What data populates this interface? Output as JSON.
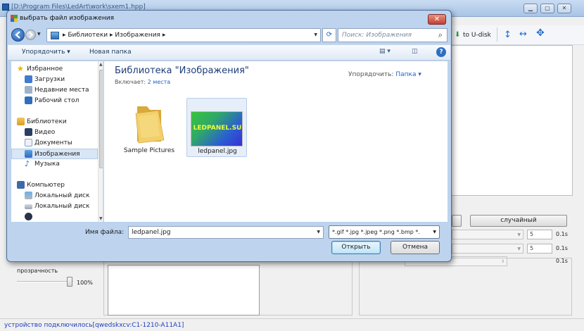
{
  "background_app": {
    "title": "[D:\\Program Files\\LedArt\\work\\sxem1.hpp]",
    "toolbar": {
      "u_disk_label": "to U-disk"
    },
    "random_button": "случайный",
    "transparency_label": "прозрачность",
    "transparency_value": "100%",
    "spin_values": [
      "5",
      "5"
    ],
    "units": [
      "0.1s",
      "0.1s",
      "0.1s"
    ],
    "status_text": "устройство подключилось[qwedskxcv:C1-1210-A11A1]"
  },
  "dialog": {
    "title": "выбрать файл изображения",
    "close_label": "✕",
    "address": {
      "crumbs": "▸  Библиотеки  ▸  Изображения  ▸"
    },
    "search_placeholder": "Поиск: Изображения",
    "commands": {
      "organize": "Упорядочить ▾",
      "new_folder": "Новая папка"
    },
    "nav": {
      "favorites_header": "Избранное",
      "favorites": [
        "Загрузки",
        "Недавние места",
        "Рабочий стол"
      ],
      "libraries_header": "Библиотеки",
      "libraries": [
        "Видео",
        "Документы",
        "Изображения",
        "Музыка"
      ],
      "selected_library": "Изображения",
      "computer_header": "Компьютер",
      "computer": [
        "Локальный диск",
        "Локальный диск"
      ]
    },
    "content": {
      "library_title": "Библиотека \"Изображения\"",
      "includes_label": "Включает:",
      "includes_link": "2 места",
      "arrange_label": "Упорядочить:",
      "arrange_value": "Папка ▾",
      "items": [
        {
          "name": "Sample Pictures",
          "type": "folder"
        },
        {
          "name": "ledpanel.jpg",
          "type": "image",
          "thumb_text": "LEDPANEL.SU"
        }
      ]
    },
    "filename_label": "Имя файла:",
    "filename_value": "ledpanel.jpg",
    "filter_value": "*.gif *.jpg *.jpeg *.png *.bmp *.",
    "open_button": "Открыть",
    "cancel_button": "Отмена"
  },
  "colors": {
    "accent": "#2563c9",
    "status": "#1f3fbf"
  }
}
